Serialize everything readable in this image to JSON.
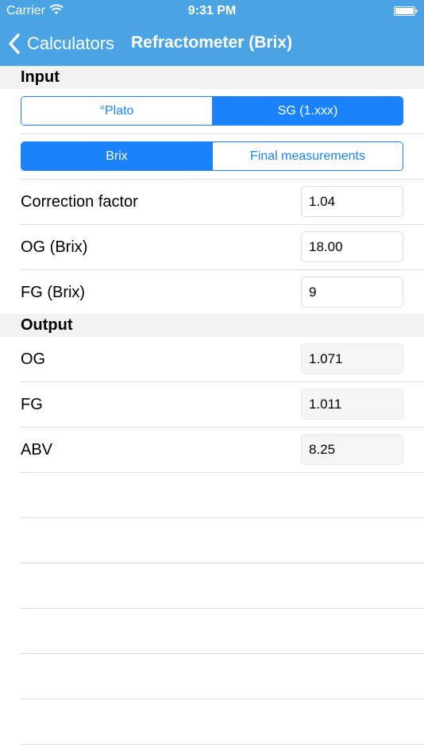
{
  "status_bar": {
    "carrier": "Carrier",
    "time": "9:31 PM",
    "wifi_icon": "wifi-icon",
    "battery_icon": "battery-icon"
  },
  "nav": {
    "back_label": "Calculators",
    "back_icon": "chevron-left-icon",
    "title": "Refractometer (Brix)"
  },
  "colors": {
    "nav_background": "#4aa4e4",
    "accent": "#1a82fb",
    "section_background": "#f2f2f2"
  },
  "input": {
    "header": "Input",
    "gravity_unit": {
      "options": [
        "°Plato",
        "SG (1.xxx)"
      ],
      "selected": "SG (1.xxx)"
    },
    "measurement_mode": {
      "options": [
        "Brix",
        "Final measurements"
      ],
      "selected": "Brix"
    },
    "fields": [
      {
        "label": "Correction factor",
        "value": "1.04"
      },
      {
        "label": "OG (Brix)",
        "value": "18.00"
      },
      {
        "label": "FG (Brix)",
        "value": "9"
      }
    ]
  },
  "output": {
    "header": "Output",
    "fields": [
      {
        "label": "OG",
        "value": "1.071"
      },
      {
        "label": "FG",
        "value": "1.011"
      },
      {
        "label": "ABV",
        "value": "8.25"
      }
    ]
  }
}
